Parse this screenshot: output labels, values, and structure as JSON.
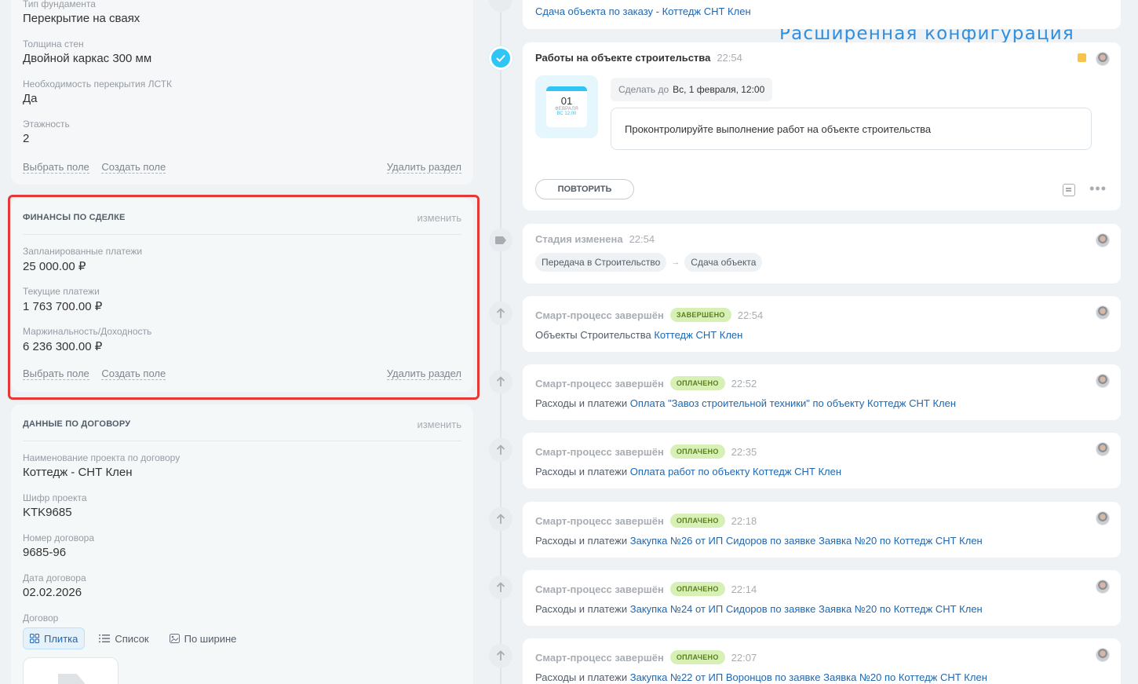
{
  "overlay": {
    "title": "Расширенная конфигурация"
  },
  "left": {
    "top_card": {
      "fields": [
        {
          "label": "Тип фундамента",
          "value": "Перекрытие на сваях"
        },
        {
          "label": "Толщина стен",
          "value": "Двойной каркас 300 мм"
        },
        {
          "label": "Необходимость перекрытия ЛСТК",
          "value": "Да"
        },
        {
          "label": "Этажность",
          "value": "2"
        }
      ],
      "select_field": "Выбрать поле",
      "create_field": "Создать поле",
      "delete_section": "Удалить раздел"
    },
    "finance_card": {
      "title": "ФИНАНСЫ ПО СДЕЛКЕ",
      "edit": "изменить",
      "fields": [
        {
          "label": "Запланированные платежи",
          "value": "25 000.00 ₽"
        },
        {
          "label": "Текущие платежи",
          "value": "1 763 700.00 ₽"
        },
        {
          "label": "Маржинальность/Доходность",
          "value": "6 236 300.00 ₽"
        }
      ],
      "select_field": "Выбрать поле",
      "create_field": "Создать поле",
      "delete_section": "Удалить раздел"
    },
    "contract_card": {
      "title": "ДАННЫЕ ПО ДОГОВОРУ",
      "edit": "изменить",
      "fields": [
        {
          "label": "Наименование проекта по договору",
          "value": "Коттедж - СНТ Клен"
        },
        {
          "label": "Шифр проекта",
          "value": "KTK9685"
        },
        {
          "label": "Номер договора",
          "value": "9685-96"
        },
        {
          "label": "Дата договора",
          "value": "02.02.2026"
        }
      ],
      "file_label": "Договор",
      "view_tabs": [
        "Плитка",
        "Список",
        "По ширине"
      ]
    }
  },
  "timeline": {
    "first": {
      "link": "Сдача объекта по заказу - Коттедж СНТ Клен"
    },
    "task": {
      "title": "Работы на объекте строительства",
      "time": "22:54",
      "cal_day": "01",
      "cal_month": "ФЕВРАЛЯ",
      "cal_sub": "ВС 12:00",
      "deadline_label": "Сделать до",
      "deadline_value": "Вс, 1 февраля, 12:00",
      "text": "Проконтролируйте выполнение работ на объекте строительства",
      "repeat": "ПОВТОРИТЬ",
      "more": "•••"
    },
    "stage": {
      "title": "Стадия изменена",
      "time": "22:54",
      "from": "Передача в Строительство",
      "to": "Сдача объекта"
    },
    "events": [
      {
        "title": "Смарт-процесс завершён",
        "badge": "ЗАВЕРШЕНО",
        "time": "22:54",
        "prefix": "Объекты Строительства",
        "link": "Коттедж СНТ Клен"
      },
      {
        "title": "Смарт-процесс завершён",
        "badge": "ОПЛАЧЕНО",
        "time": "22:52",
        "prefix": "Расходы и платежи",
        "link": "Оплата \"Завоз строительной техники\" по объекту Коттедж СНТ Клен"
      },
      {
        "title": "Смарт-процесс завершён",
        "badge": "ОПЛАЧЕНО",
        "time": "22:35",
        "prefix": "Расходы и платежи",
        "link": "Оплата работ по объекту Коттедж СНТ Клен"
      },
      {
        "title": "Смарт-процесс завершён",
        "badge": "ОПЛАЧЕНО",
        "time": "22:18",
        "prefix": "Расходы и платежи",
        "link": "Закупка №26 от ИП Сидоров по заявке Заявка №20 по Коттедж СНТ Клен"
      },
      {
        "title": "Смарт-процесс завершён",
        "badge": "ОПЛАЧЕНО",
        "time": "22:14",
        "prefix": "Расходы и платежи",
        "link": "Закупка №24 от ИП Сидоров по заявке Заявка №20 по Коттедж СНТ Клен"
      },
      {
        "title": "Смарт-процесс завершён",
        "badge": "ОПЛАЧЕНО",
        "time": "22:07",
        "prefix": "Расходы и платежи",
        "link": "Закупка №22 от ИП Воронцов по заявке Заявка №20 по Коттедж СНТ Клен"
      }
    ]
  }
}
